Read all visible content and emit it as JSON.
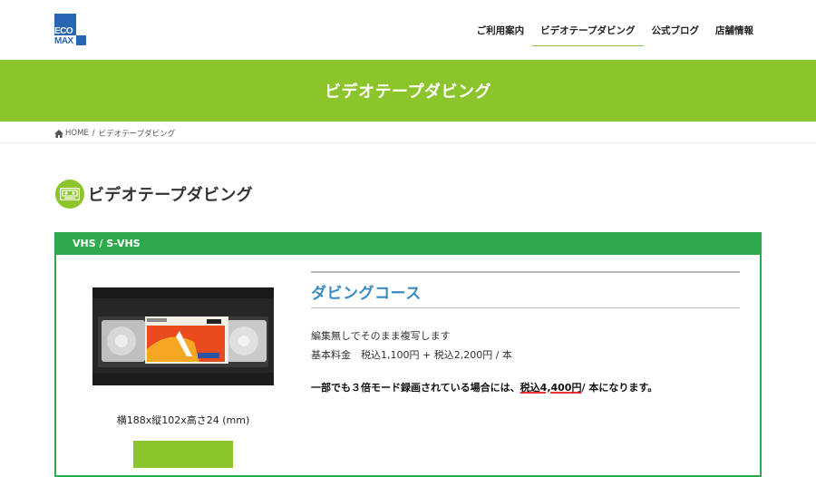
{
  "logo": {
    "line1": "ECO",
    "line2": "MAX"
  },
  "nav": [
    {
      "label": "ご利用案内"
    },
    {
      "label": "ビデオテープダビング"
    },
    {
      "label": "公式ブログ"
    },
    {
      "label": "店舗情報"
    }
  ],
  "banner": {
    "title": "ビデオテープダビング"
  },
  "breadcrumb": {
    "home": "HOME",
    "separator": "/",
    "current": "ビデオテープダビング"
  },
  "section": {
    "title": "ビデオテープダビング"
  },
  "box": {
    "header": "VHS / S-VHS"
  },
  "product": {
    "size": "横188x縦102x高さ24 (mm)"
  },
  "course": {
    "title": "ダビングコース",
    "desc1": "編集無しでそのまま複写します",
    "desc2": "基本料金　税込1,100円 + 税込2,200円 / 本",
    "note_pre": "一部でも３倍モード録画されている場合には、",
    "note_emph": "税込4,400円",
    "note_post": "/ 本になります。"
  },
  "colors": {
    "accent_green": "#8cc52b",
    "box_green": "#2eaa4c",
    "logo_blue": "#2a66b4",
    "course_blue": "#3a8ac2"
  }
}
